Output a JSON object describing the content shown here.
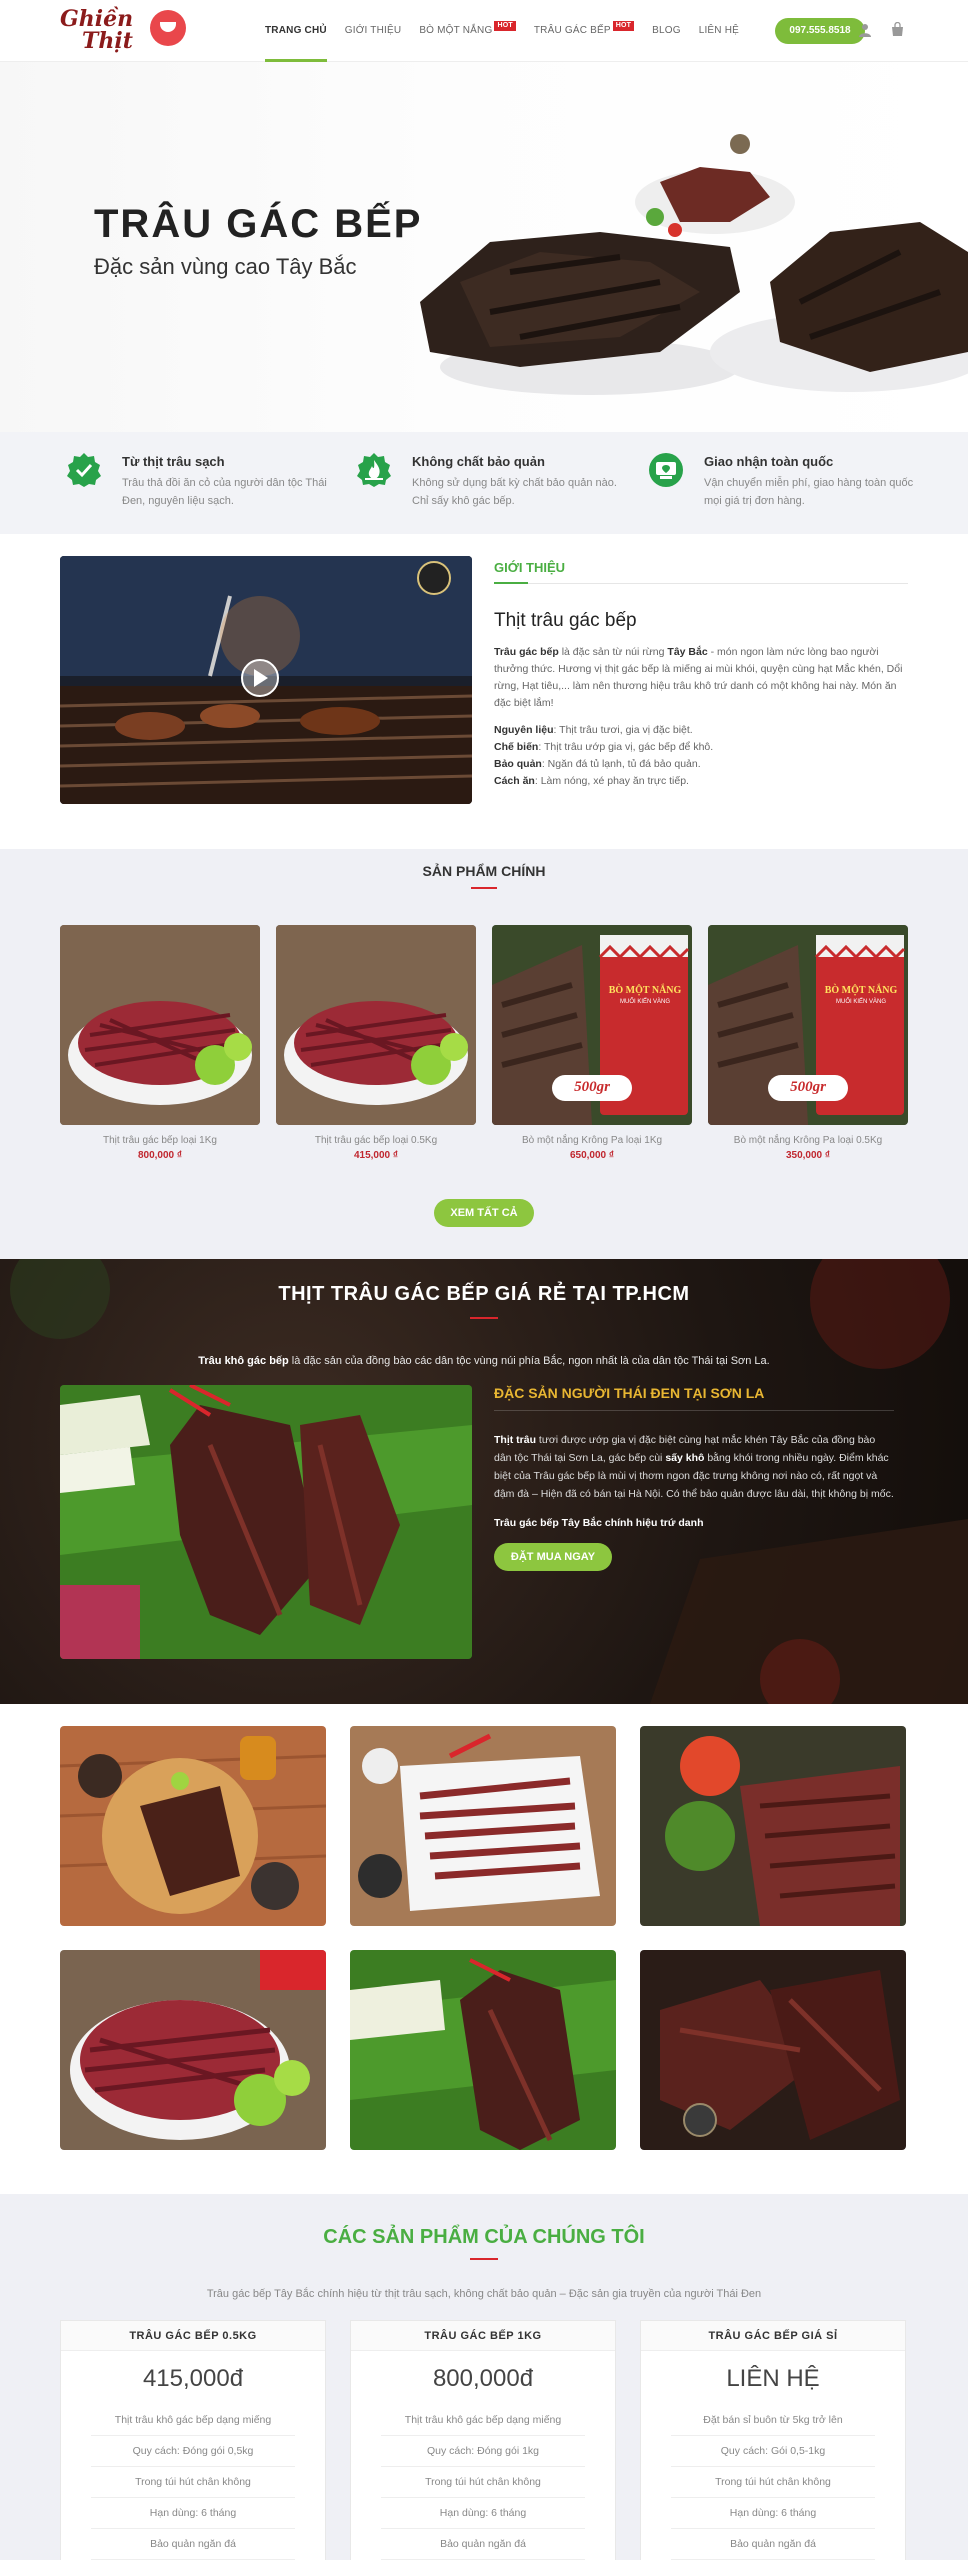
{
  "header": {
    "logo_line1": "Ghiền",
    "logo_line2": "Thịt",
    "nav": [
      {
        "label": "TRANG CHỦ",
        "active": true,
        "hot": false
      },
      {
        "label": "GIỚI THIỆU",
        "active": false,
        "hot": false
      },
      {
        "label": "BÒ MỘT NẮNG",
        "active": false,
        "hot": true
      },
      {
        "label": "TRÂU GÁC BẾP",
        "active": false,
        "hot": true
      },
      {
        "label": "BLOG",
        "active": false,
        "hot": false
      },
      {
        "label": "LIÊN HỆ",
        "active": false,
        "hot": false
      }
    ],
    "hot_label": "HOT",
    "phone": "097.555.8518"
  },
  "hero": {
    "title": "TRÂU GÁC BẾP",
    "subtitle": "Đặc sản vùng cao Tây Bắc"
  },
  "features": [
    {
      "title": "Từ thịt trâu sạch",
      "text": "Trâu thả đồi ăn cỏ của người dân tộc Thái Đen, nguyên liệu sạch.",
      "icon": "check-badge-icon"
    },
    {
      "title": "Không chất bảo quản",
      "text": "Không sử dụng bất kỳ chất bảo quản nào. Chỉ sấy khô gác bếp.",
      "icon": "fire-badge-icon"
    },
    {
      "title": "Giao nhận toàn quốc",
      "text": "Vận chuyển miễn phí, giao hàng toàn quốc mọi giá trị đơn hàng.",
      "icon": "location-badge-icon"
    }
  ],
  "intro": {
    "label": "GIỚI THIỆU",
    "heading": "Thịt trâu gác bếp",
    "para_strong1": "Trâu gác bếp",
    "para_mid": " là đặc sản từ núi rừng ",
    "para_strong2": "Tây Bắc",
    "para_rest": " - món ngon làm nức lòng bao người thưởng thức. Hương vị thịt gác bếp là miếng ai mùi khói, quyện cùng hạt Mắc khén, Dổi rừng, Hạt tiêu,... làm nên thương hiệu trâu khô trứ danh có một không hai này. Món ăn đặc biệt lắm!",
    "specs": [
      {
        "k": "Nguyên liệu",
        "v": ": Thịt trâu tươi, gia vị đặc biệt."
      },
      {
        "k": "Chế biến",
        "v": ": Thịt trâu ướp gia vị, gác bếp để khô."
      },
      {
        "k": "Bảo quản",
        "v": ": Ngăn đá tủ lạnh, tủ đá bảo quản."
      },
      {
        "k": "Cách ăn",
        "v": ": Làm nóng, xé phay ăn trực tiếp."
      }
    ]
  },
  "products": {
    "title": "SẢN PHẨM CHÍNH",
    "items": [
      {
        "name": "Thịt trâu gác bếp loại 1Kg",
        "price": "800,000 ₫"
      },
      {
        "name": "Thịt trâu gác bếp loại 0.5Kg",
        "price": "415,000 ₫"
      },
      {
        "name": "Bò một nắng Krông Pa loại 1Kg",
        "price": "650,000 ₫"
      },
      {
        "name": "Bò một nắng Krông Pa loại 0.5Kg",
        "price": "350,000 ₫"
      }
    ],
    "pack_text": "BÒ MỘT NẮNG",
    "pack_sub": "MUỐI KIẾN VÀNG",
    "pack_weight": "500gr",
    "view_all": "XEM TẤT CẢ"
  },
  "banner": {
    "title": "THỊT TRÂU GÁC BẾP GIÁ RẺ TẠI TP.HCM",
    "lead_strong": "Trâu khô gác bếp",
    "lead_rest": " là đặc sản của đồng bào các dân tộc vùng núi phía Bắc, ngon nhất là của dân tộc Thái tại Sơn La.",
    "heading": "ĐẶC SẢN NGƯỜI THÁI ĐEN TẠI SƠN LA",
    "p_strong1": "Thịt trâu",
    "p_mid": " tươi được ướp gia vị đặc biệt cùng hạt mắc khén Tây Bắc của đồng bào dân tộc Thái tại Sơn La, gác bếp cùi ",
    "p_strong2": "sấy khô",
    "p_rest": " bằng khói trong nhiều ngày. Điểm khác biệt của Trâu gác bếp là mùi vị thơm ngon đặc trưng không nơi nào có, rất ngọt và đậm đà – Hiện đã có bán tại Hà Nội. Có thể bảo quản được lâu dài, thịt không bị mốc.",
    "strong_line": "Trâu gác bếp Tây Bắc chính hiệu trứ danh",
    "button": "ĐẶT MUA NGAY"
  },
  "pricing": {
    "title": "CÁC SẢN PHẨM CỦA CHÚNG TÔI",
    "lead": "Trâu gác bếp Tây Bắc chính hiệu từ thịt trâu sạch, không chất bảo quản – Đặc sản gia truyền của người Thái Đen",
    "cards": [
      {
        "head": "TRÂU GÁC BẾP 0.5KG",
        "price": "415,000đ",
        "rows": [
          "Thịt trâu khô gác bếp dạng miếng",
          "Quy cách: Đóng gói 0,5kg",
          "Trong túi hút chân không",
          "Hạn dùng: 6 tháng",
          "Bảo quản ngăn đá"
        ]
      },
      {
        "head": "TRÂU GÁC BẾP 1KG",
        "price": "800,000đ",
        "rows": [
          "Thịt trâu khô gác bếp dạng miếng",
          "Quy cách: Đóng gói 1kg",
          "Trong túi hút chân không",
          "Hạn dùng: 6 tháng",
          "Bảo quản ngăn đá"
        ]
      },
      {
        "head": "TRÂU GÁC BẾP GIÁ SỈ",
        "price": "LIÊN HỆ",
        "rows": [
          "Đặt bán sỉ buôn từ 5kg trở lên",
          "Quy cách: Gói 0,5-1kg",
          "Trong túi hút chân không",
          "Hạn dùng: 6 tháng",
          "Bảo quản ngăn đá"
        ]
      }
    ]
  },
  "colors": {
    "accent_green": "#7ebc3b",
    "title_green": "#4aae42",
    "price_red": "#c0262e",
    "hot_red": "#d9262c",
    "banner_gold": "#e8b632"
  }
}
